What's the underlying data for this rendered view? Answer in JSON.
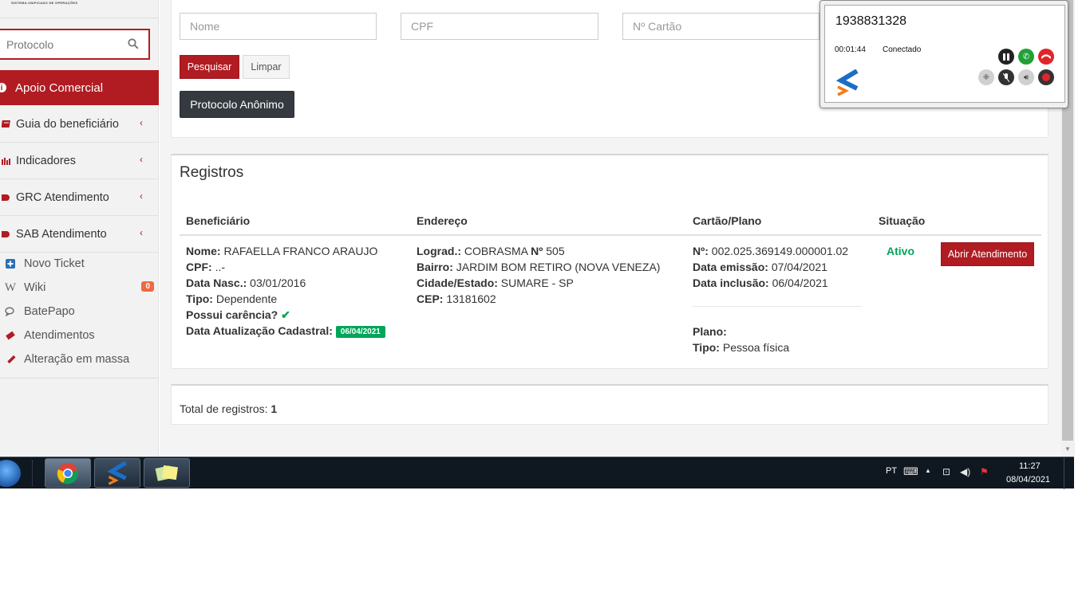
{
  "sidebar": {
    "brand_subtitle": "SISTEMA UNIFICADO DE OPERAÇÕES",
    "search_placeholder": "Protocolo",
    "active_item": "Apoio Comercial",
    "items": [
      {
        "label": "Guia do beneficiário",
        "icon": "book-icon"
      },
      {
        "label": "Indicadores",
        "icon": "bar-chart-icon"
      },
      {
        "label": "GRC Atendimento",
        "icon": "pill-icon"
      },
      {
        "label": "SAB Atendimento",
        "icon": "pill-icon"
      }
    ],
    "sub_items": [
      {
        "label": "Novo Ticket",
        "icon": "plus-square-icon"
      },
      {
        "label": "Wiki",
        "icon": "wikipedia-icon",
        "badge": "0"
      },
      {
        "label": "BatePapo",
        "icon": "chat-icon"
      },
      {
        "label": "Atendimentos",
        "icon": "ticket-icon"
      },
      {
        "label": "Alteração em massa",
        "icon": "pencil-icon"
      }
    ]
  },
  "search_form": {
    "nome_placeholder": "Nome",
    "cpf_placeholder": "CPF",
    "cartao_placeholder": "Nº Cartão",
    "pesquisar_label": "Pesquisar",
    "limpar_label": "Limpar",
    "anonimo_label": "Protocolo Anônimo"
  },
  "registros": {
    "title": "Registros",
    "columns": [
      "Beneficiário",
      "Endereço",
      "Cartão/Plano",
      "Situação"
    ],
    "row": {
      "beneficiario": {
        "nome_label": "Nome:",
        "nome": "RAFAELLA FRANCO ARAUJO",
        "cpf_label": "CPF:",
        "cpf": "..-",
        "nasc_label": "Data Nasc.:",
        "nasc": "03/01/2016",
        "tipo_label": "Tipo:",
        "tipo": "Dependente",
        "carencia_label": "Possui carência?",
        "atualizacao_label": "Data Atualização Cadastral:",
        "atualizacao": "06/04/2021"
      },
      "endereco": {
        "lograd_label": "Lograd.:",
        "lograd": "COBRASMA",
        "num_label": "Nº",
        "num": "505",
        "bairro_label": "Bairro:",
        "bairro": "JARDIM BOM RETIRO (NOVA VENEZA)",
        "cidade_label": "Cidade/Estado:",
        "cidade": "SUMARE - SP",
        "cep_label": "CEP:",
        "cep": "13181602"
      },
      "cartao": {
        "num_label": "Nº:",
        "num": "002.025.369149.000001.02",
        "emissao_label": "Data emissão:",
        "emissao": "07/04/2021",
        "inclusao_label": "Data inclusão:",
        "inclusao": "06/04/2021",
        "plano_label": "Plano:",
        "plano": "",
        "tipo_label": "Tipo:",
        "tipo": "Pessoa física"
      },
      "situacao": "Ativo",
      "action_label": "Abrir Atendimento"
    }
  },
  "total": {
    "label": "Total de registros:",
    "value": "1"
  },
  "phone": {
    "number": "1938831328",
    "timer": "00:01:44",
    "status": "Conectado"
  },
  "taskbar": {
    "lang": "PT",
    "time": "11:27",
    "date": "08/04/2021"
  },
  "colors": {
    "brand_red": "#b01c22",
    "success_green": "#00a65a",
    "dark_button": "#353a40"
  }
}
